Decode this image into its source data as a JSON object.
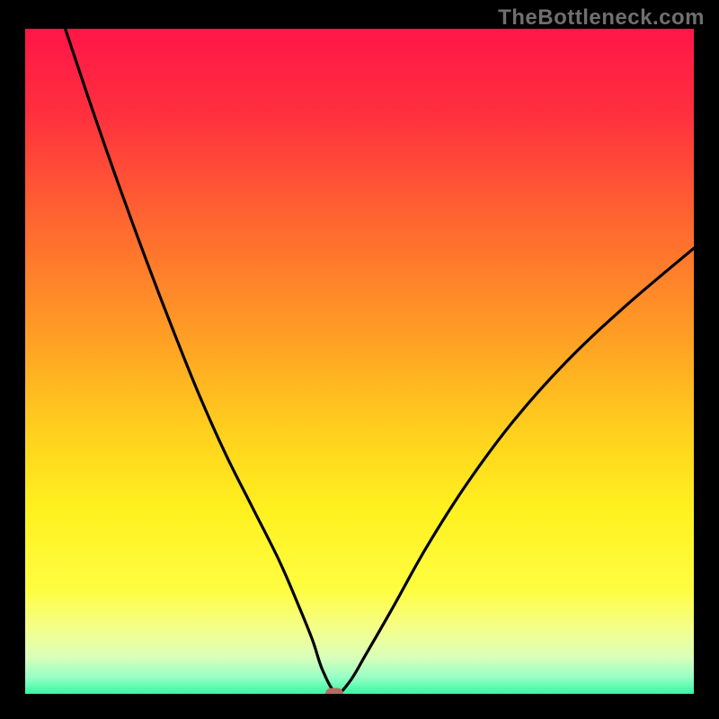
{
  "watermark": "TheBottleneck.com",
  "colors": {
    "frame_bg": "#000000",
    "marker": "#b86a60",
    "curve": "#000000"
  },
  "gradient_stops": [
    {
      "offset": 0,
      "color": "#ff1648"
    },
    {
      "offset": 12,
      "color": "#ff2e3f"
    },
    {
      "offset": 30,
      "color": "#ff6a2f"
    },
    {
      "offset": 45,
      "color": "#ff9b25"
    },
    {
      "offset": 60,
      "color": "#ffcf1e"
    },
    {
      "offset": 72,
      "color": "#fff11f"
    },
    {
      "offset": 84,
      "color": "#fffd42"
    },
    {
      "offset": 90,
      "color": "#f3ff8e"
    },
    {
      "offset": 94,
      "color": "#d9ffba"
    },
    {
      "offset": 97,
      "color": "#96ffc5"
    },
    {
      "offset": 100,
      "color": "#22f59a"
    }
  ],
  "chart_data": {
    "type": "line",
    "title": "",
    "xlabel": "",
    "ylabel": "",
    "xlim": [
      0,
      100
    ],
    "ylim": [
      0,
      100
    ],
    "series": [
      {
        "name": "bottleneck-curve",
        "x": [
          6,
          10,
          14,
          18,
          22,
          26,
          30,
          34,
          38,
          41,
          43,
          44.5,
          46.5,
          48.5,
          51,
          55,
          60,
          66,
          73,
          81,
          90,
          100
        ],
        "y": [
          100,
          88,
          76.5,
          65.5,
          55,
          45,
          36,
          28,
          20,
          13,
          8,
          3.5,
          0.2,
          1.8,
          6,
          13,
          22,
          31.5,
          41,
          50,
          58.5,
          67
        ]
      }
    ],
    "marker": {
      "x": 46.3,
      "y": 0.0
    }
  }
}
